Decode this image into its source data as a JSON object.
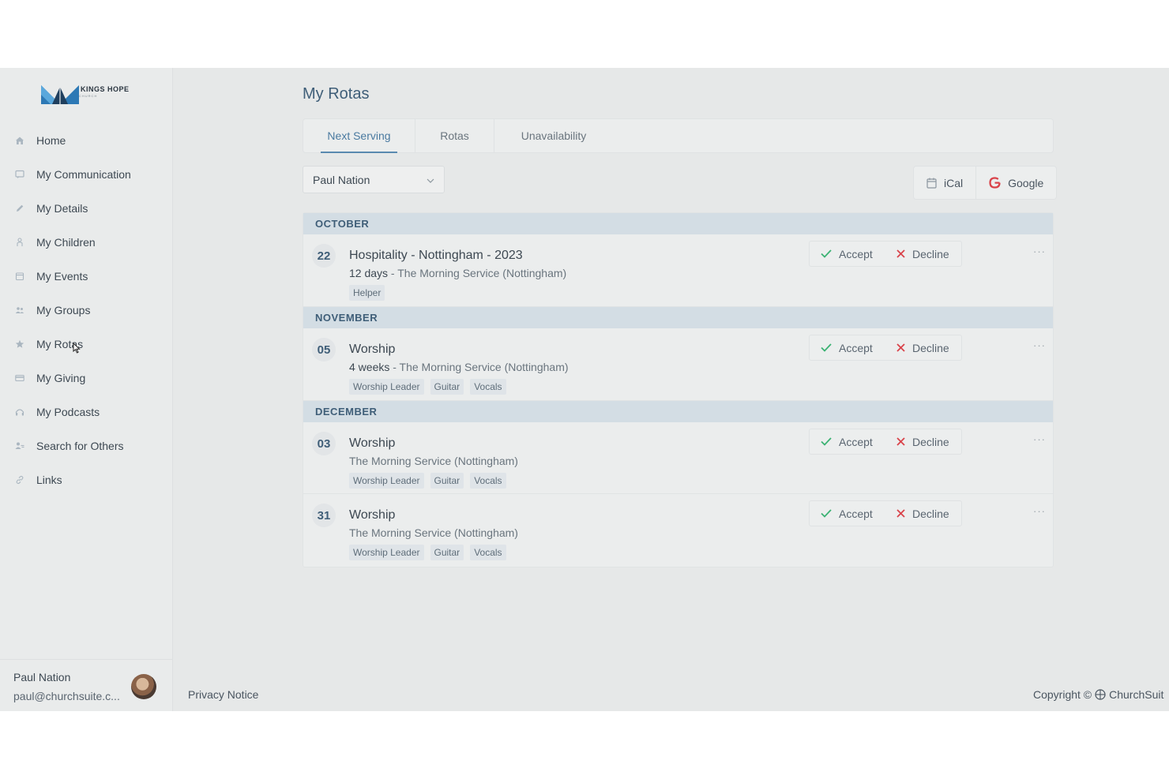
{
  "brand": {
    "name": "KINGS HOPE",
    "sub": "CHURCH"
  },
  "sidebar": {
    "items": [
      {
        "label": "Home",
        "icon": "home-icon"
      },
      {
        "label": "My Communication",
        "icon": "message-icon"
      },
      {
        "label": "My Details",
        "icon": "pencil-icon"
      },
      {
        "label": "My Children",
        "icon": "child-icon"
      },
      {
        "label": "My Events",
        "icon": "calendar-icon"
      },
      {
        "label": "My Groups",
        "icon": "users-icon"
      },
      {
        "label": "My Rotas",
        "icon": "star-icon"
      },
      {
        "label": "My Giving",
        "icon": "credit-card-icon"
      },
      {
        "label": "My Podcasts",
        "icon": "headphones-icon"
      },
      {
        "label": "Search for Others",
        "icon": "user-search-icon"
      },
      {
        "label": "Links",
        "icon": "link-icon"
      }
    ],
    "active": "My Rotas"
  },
  "user": {
    "name": "Paul Nation",
    "email": "paul@churchsuite.c..."
  },
  "main": {
    "title": "My Rotas",
    "tabs": [
      {
        "label": "Next Serving",
        "active": true
      },
      {
        "label": "Rotas",
        "active": false
      },
      {
        "label": "Unavailability",
        "active": false
      }
    ],
    "person_select": {
      "value": "Paul Nation"
    },
    "calendar_buttons": {
      "ical": "iCal",
      "google": "Google"
    },
    "action_labels": {
      "accept": "Accept",
      "decline": "Decline",
      "more": "···"
    },
    "months": [
      {
        "name": "OCTOBER",
        "entries": [
          {
            "day": "22",
            "title": "Hospitality - Nottingham - 2023",
            "countdown": "12 days",
            "service": " - The Morning Service (Nottingham)",
            "tags": [
              "Helper"
            ]
          }
        ]
      },
      {
        "name": "NOVEMBER",
        "entries": [
          {
            "day": "05",
            "title": "Worship",
            "countdown": "4 weeks",
            "service": " - The Morning Service (Nottingham)",
            "tags": [
              "Worship Leader",
              "Guitar",
              "Vocals"
            ]
          }
        ]
      },
      {
        "name": "DECEMBER",
        "entries": [
          {
            "day": "03",
            "title": "Worship",
            "countdown": "",
            "service": "The Morning Service (Nottingham)",
            "tags": [
              "Worship Leader",
              "Guitar",
              "Vocals"
            ]
          },
          {
            "day": "31",
            "title": "Worship",
            "countdown": "",
            "service": "The Morning Service (Nottingham)",
            "tags": [
              "Worship Leader",
              "Guitar",
              "Vocals"
            ]
          }
        ]
      }
    ]
  },
  "footer": {
    "privacy": "Privacy Notice",
    "copyright_prefix": "Copyright ©",
    "copyright_brand": "ChurchSuit"
  },
  "colors": {
    "accent": "#3f5e78",
    "accept": "#3bb273",
    "decline": "#d9434a",
    "google": "#d9434a",
    "month_band": "#d3dde4"
  }
}
